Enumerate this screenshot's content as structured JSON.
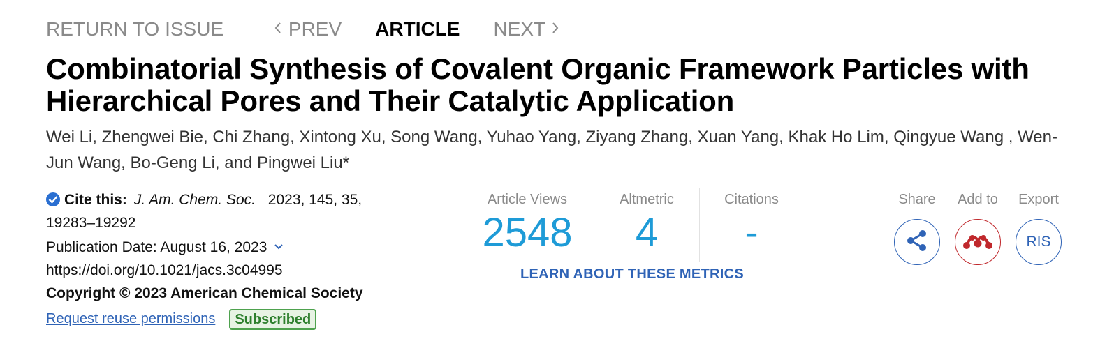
{
  "nav": {
    "return_label": "RETURN TO ISSUE",
    "prev_label": "PREV",
    "current_label": "ARTICLE",
    "next_label": "NEXT"
  },
  "article": {
    "title": "Combinatorial Synthesis of Covalent Organic Framework Particles with Hierarchical Pores and Their Catalytic Application",
    "authors": "Wei Li, Zhengwei Bie, Chi Zhang, Xintong Xu, Song Wang, Yuhao Yang, Ziyang Zhang, Xuan Yang, Khak Ho Lim, Qingyue Wang , Wen-Jun Wang, Bo-Geng Li, and Pingwei Liu*"
  },
  "cite": {
    "label": "Cite this:",
    "journal": "J. Am. Chem. Soc.",
    "details": "2023, 145, 35, 19283–19292",
    "publication_date": "Publication Date: August 16, 2023",
    "doi": "https://doi.org/10.1021/jacs.3c04995",
    "copyright": "Copyright © 2023 American Chemical Society",
    "reuse_link": "Request reuse permissions",
    "badge": "Subscribed"
  },
  "metrics": {
    "views_label": "Article Views",
    "views_value": "2548",
    "altmetric_label": "Altmetric",
    "altmetric_value": "4",
    "citations_label": "Citations",
    "citations_value": "-",
    "learn_link": "LEARN ABOUT THESE METRICS"
  },
  "actions": {
    "share_label": "Share",
    "add_label": "Add to",
    "export_label": "Export",
    "ris_label": "RIS"
  },
  "colors": {
    "metric_value": "#1e9bd7",
    "link": "#2f63b6",
    "mendeley_red": "#c0282c",
    "subscribed_green": "#2d7f2d"
  },
  "icons": [
    "chevron-left-icon",
    "chevron-right-icon",
    "verified-check-icon",
    "chevron-down-icon",
    "share-icon",
    "mendeley-icon"
  ]
}
